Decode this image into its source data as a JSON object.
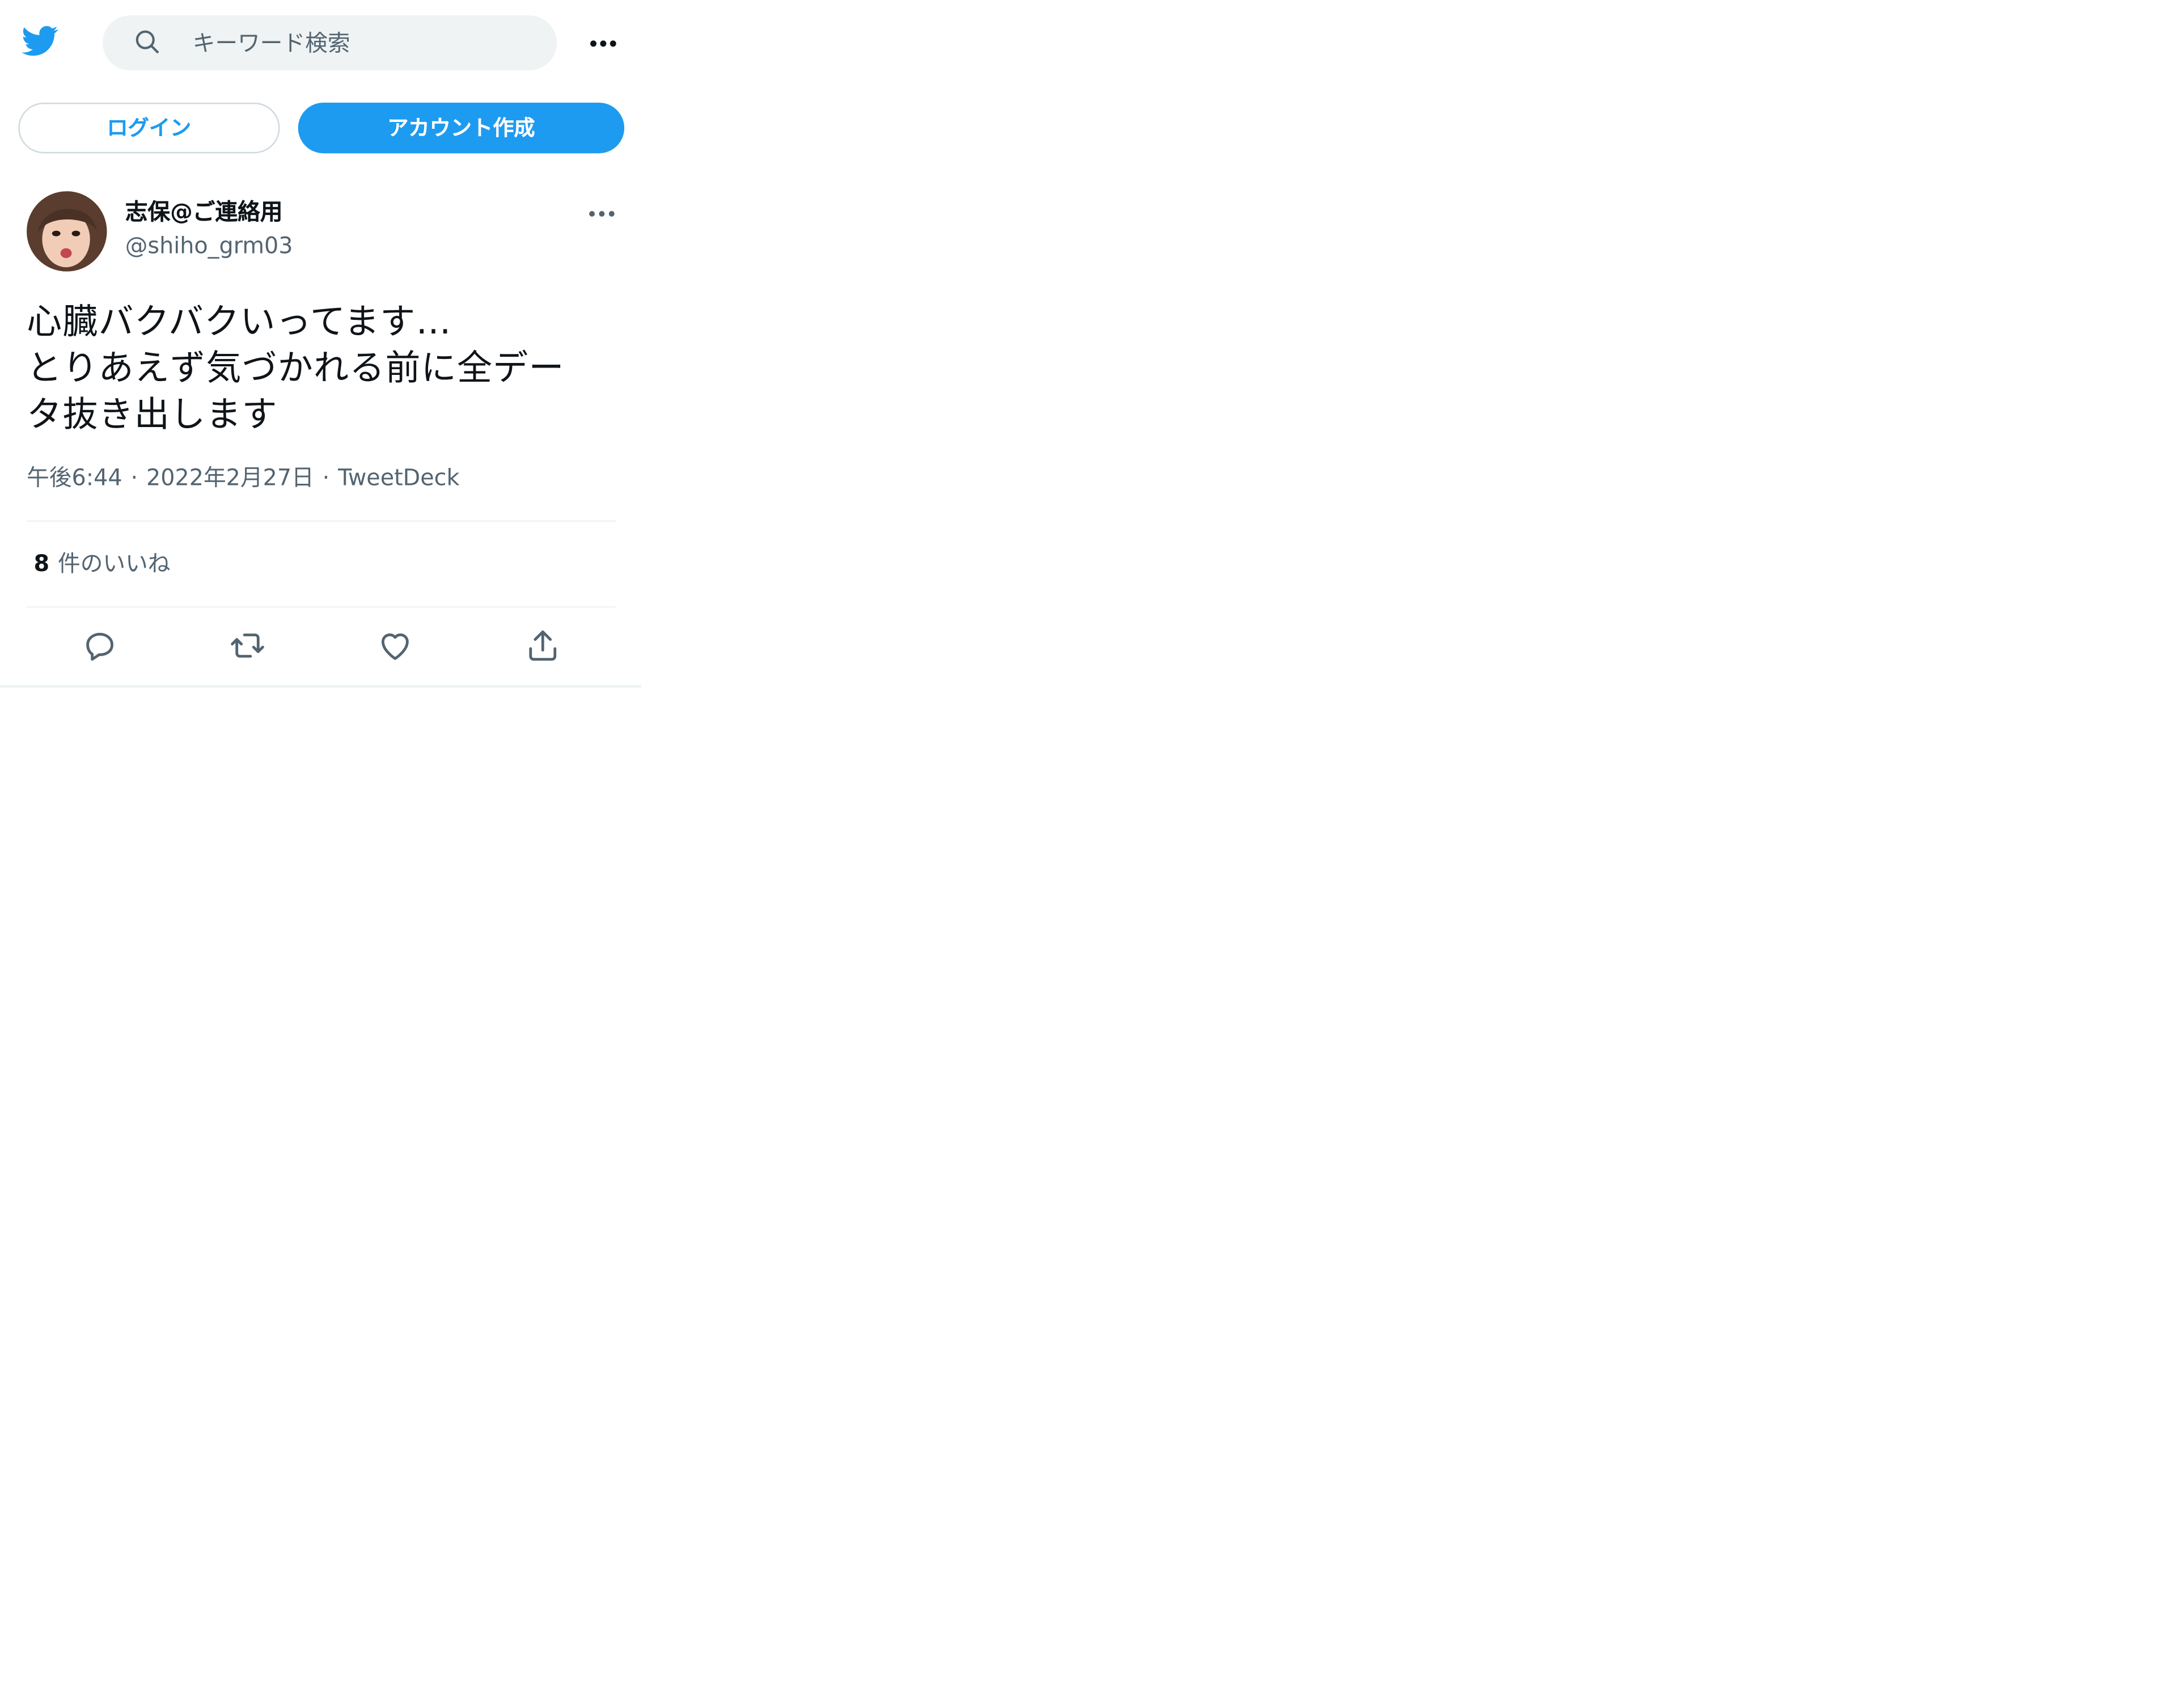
{
  "header": {
    "logo_icon": "twitter-bird-icon",
    "search": {
      "placeholder": "キーワード検索",
      "icon": "search-icon"
    },
    "more_icon": "more-dots-icon"
  },
  "auth": {
    "login_label": "ログイン",
    "signup_label": "アカウント作成"
  },
  "tweet": {
    "author": {
      "name": "志保@ご連絡用",
      "handle": "@shiho_grm03"
    },
    "text": "心臓バクバクいってます…\nとりあえず気づかれる前に全デー\nタ抜き出します",
    "time": "午後6:44",
    "date": "2022年2月27日",
    "source": "TweetDeck",
    "separator": "·",
    "likes": {
      "count": "8",
      "label": "件のいいね"
    },
    "actions": [
      "reply-icon",
      "retweet-icon",
      "like-icon",
      "share-icon"
    ]
  },
  "colors": {
    "accent": "#1d9bf0",
    "text": "#0f1419",
    "muted": "#536471",
    "border": "#cfd9de",
    "search_bg": "#eff3f4"
  }
}
